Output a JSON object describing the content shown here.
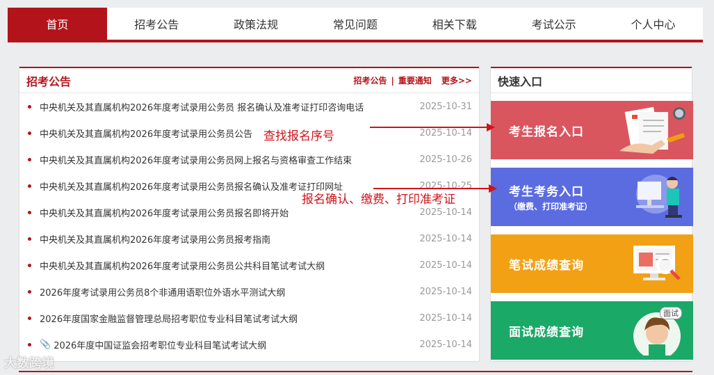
{
  "nav": {
    "items": [
      {
        "label": "首页",
        "active": true
      },
      {
        "label": "招考公告",
        "active": false
      },
      {
        "label": "政策法规",
        "active": false
      },
      {
        "label": "常见问题",
        "active": false
      },
      {
        "label": "相关下载",
        "active": false
      },
      {
        "label": "考试公示",
        "active": false
      },
      {
        "label": "个人中心",
        "active": false
      }
    ]
  },
  "news": {
    "title": "招考公告",
    "link1": "招考公告",
    "sep": "|",
    "link2": "重要通知",
    "more": "更多>>",
    "items": [
      {
        "title": "中央机关及其直属机构2026年度考试录用公务员 报名确认及准考证打印咨询电话",
        "date": "2025-10-31"
      },
      {
        "title": "中央机关及其直属机构2026年度考试录用公务员公告",
        "date": "2025-10-14"
      },
      {
        "title": "中央机关及其直属机构2026年度考试录用公务员网上报名与资格审查工作结束",
        "date": "2025-10-26"
      },
      {
        "title": "中央机关及其直属机构2026年度考试录用公务员报名确认及准考证打印网址",
        "date": "2025-10-25"
      },
      {
        "title": "中央机关及其直属机构2026年度考试录用公务员报名即将开始",
        "date": "2025-10-14"
      },
      {
        "title": "中央机关及其直属机构2026年度考试录用公务员报考指南",
        "date": "2025-10-14"
      },
      {
        "title": "中央机关及其直属机构2026年度考试录用公务员公共科目笔试考试大纲",
        "date": "2025-10-14"
      },
      {
        "title": "2026年度考试录用公务员8个非通用语职位外语水平测试大纲",
        "date": "2025-10-14"
      },
      {
        "title": "2026年度国家金融监督管理总局招考职位专业科目笔试考试大纲",
        "date": "2025-10-14"
      },
      {
        "title": "2026年度中国证监会招考职位专业科目笔试考试大纲",
        "date": "2025-10-14",
        "attachment": true
      }
    ]
  },
  "quick": {
    "title": "快速入口",
    "buttons": [
      {
        "label": "考生报名入口",
        "sub": "",
        "color": "#d9565f"
      },
      {
        "label": "考生考务入口",
        "sub": "（缴费、打印准考证）",
        "color": "#5b6ce0"
      },
      {
        "label": "笔试成绩查询",
        "sub": "",
        "color": "#f2a014"
      },
      {
        "label": "面试成绩查询",
        "sub": "",
        "color": "#1ba968"
      }
    ],
    "interview_tag": "面试"
  },
  "annotations": {
    "a1": "查找报名序号",
    "a2": "报名确认、缴费、打印准考证"
  },
  "watermark": "大数跨境",
  "colors": {
    "brand": "#b3141b",
    "annotation": "#d0131a"
  }
}
